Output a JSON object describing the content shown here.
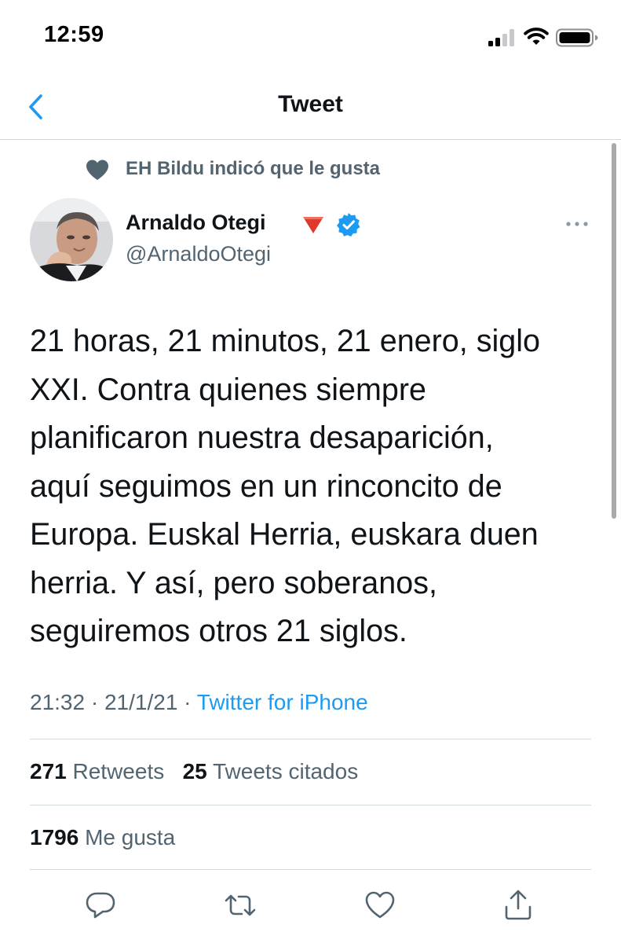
{
  "status_bar": {
    "time": "12:59"
  },
  "nav": {
    "title": "Tweet",
    "back_icon": "chevron-left-icon"
  },
  "social_context": {
    "text": "EH Bildu indicó que le gusta",
    "icon": "heart-filled-icon"
  },
  "author": {
    "name": "Arnaldo Otegi",
    "name_emoji": "🔻",
    "handle": "@ArnaldoOtegi",
    "verified": true,
    "verified_color": "#1d9bf0"
  },
  "tweet": {
    "text": "21 horas, 21 minutos, 21 enero, siglo\nXXI. Contra quienes siempre\nplanificaron nuestra desaparición,\naquí seguimos en un rinconcito de\nEuropa. Euskal Herria, euskara duen\nherria. Y así, pero soberanos,\nseguiremos otros 21 siglos.",
    "time": "21:32",
    "date": "21/1/21",
    "separator": "·",
    "source": "Twitter for iPhone"
  },
  "stats": {
    "retweets_count": "271",
    "retweets_label": "Retweets",
    "quotes_count": "25",
    "quotes_label": "Tweets citados",
    "likes_count": "1796",
    "likes_label": "Me gusta"
  },
  "actions": [
    "reply-icon",
    "retweet-icon",
    "like-icon",
    "share-icon"
  ],
  "colors": {
    "accent": "#1d9bf0",
    "text_primary": "#0f1419",
    "text_secondary": "#536471",
    "divider": "#cfd9de"
  }
}
